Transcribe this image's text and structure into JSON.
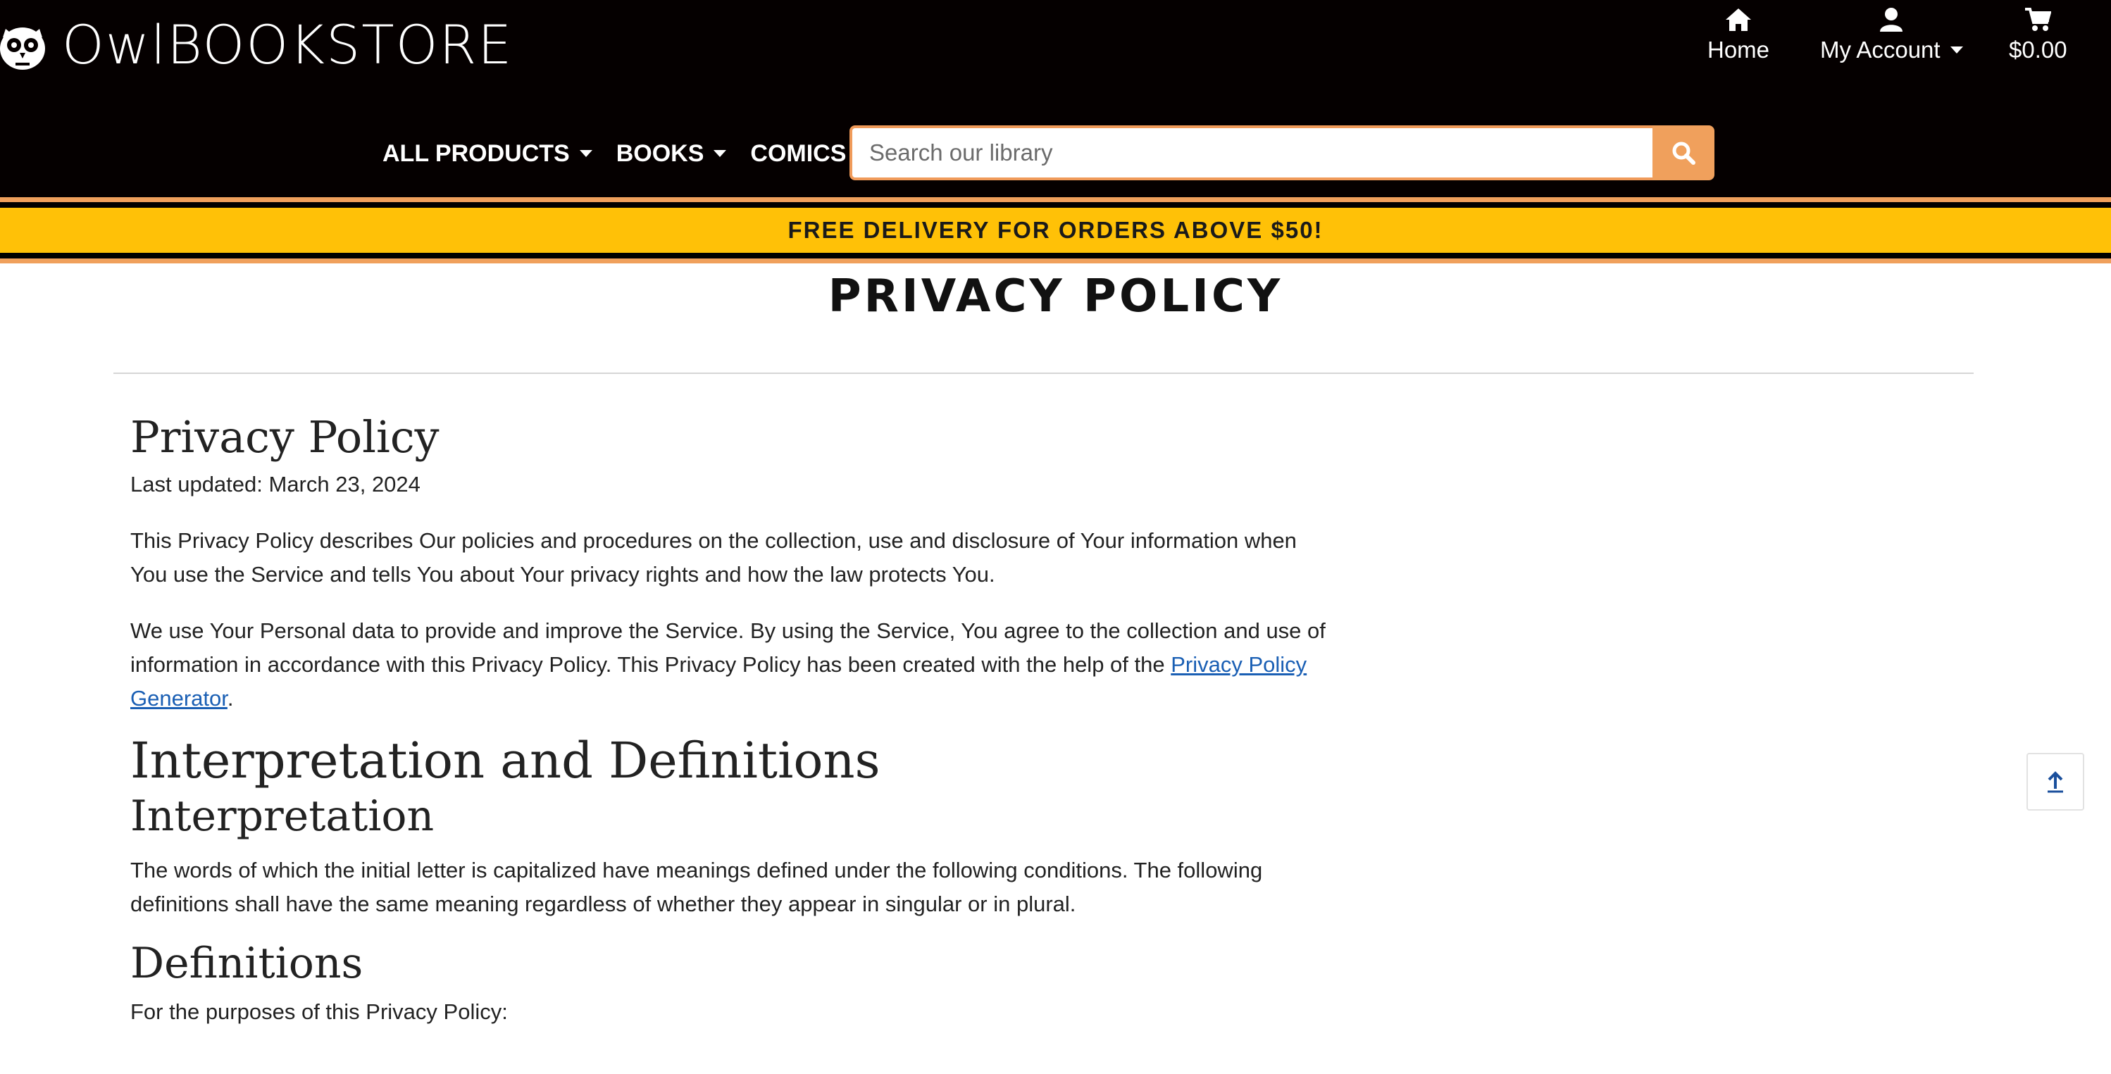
{
  "brand": {
    "prefix": "Owl",
    "name": "BOOKSTORE"
  },
  "header": {
    "home_label": "Home",
    "account_label": "My Account",
    "cart_total": "$0.00"
  },
  "nav": {
    "all_products": "ALL PRODUCTS",
    "books": "BOOKS",
    "comics": "COMICS"
  },
  "search": {
    "placeholder": "Search our library",
    "value": ""
  },
  "promo": {
    "text": "FREE DELIVERY FOR ORDERS ABOVE $50!"
  },
  "page": {
    "title": "PRIVACY POLICY"
  },
  "policy": {
    "heading": "Privacy Policy",
    "last_updated": "Last updated: March 23, 2024",
    "intro": "This Privacy Policy describes Our policies and procedures on the collection, use and disclosure of Your information when You use the Service and tells You about Your privacy rights and how the law protects You.",
    "usage_text": "We use Your Personal data to provide and improve the Service. By using the Service, You agree to the collection and use of information in accordance with this Privacy Policy. This Privacy Policy has been created with the help of the ",
    "generator_link": "Privacy Policy Generator",
    "usage_end": ".",
    "section_heading": "Interpretation and Definitions",
    "interpretation_heading": "Interpretation",
    "interpretation_text": "The words of which the initial letter is capitalized have meanings defined under the following conditions. The following definitions shall have the same meaning regardless of whether they appear in singular or in plural.",
    "definitions_heading": "Definitions",
    "definitions_text": "For the purposes of this Privacy Policy:"
  },
  "colors": {
    "header_bg": "#050000",
    "accent_orange": "#f0a05c",
    "promo_yellow": "#ffc107",
    "link_blue": "#1a5fb4"
  },
  "icons": [
    "owl-logo-icon",
    "home-icon",
    "user-icon",
    "cart-icon",
    "search-icon",
    "arrow-up-icon"
  ]
}
